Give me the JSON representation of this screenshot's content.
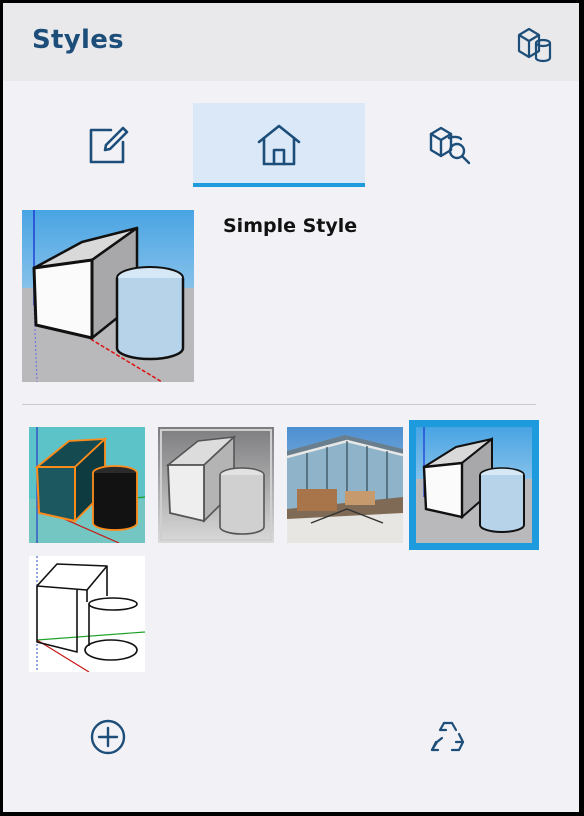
{
  "header": {
    "title": "Styles",
    "icon": "styles-cubes-icon"
  },
  "tabs": [
    {
      "name": "edit",
      "icon": "edit-icon",
      "active": false
    },
    {
      "name": "home",
      "icon": "home-icon",
      "active": true
    },
    {
      "name": "browse",
      "icon": "search-model-icon",
      "active": false
    }
  ],
  "current_style": {
    "name": "Simple Style"
  },
  "thumbnails": [
    {
      "style": "teal-orange-outline",
      "selected": false
    },
    {
      "style": "grayscale",
      "selected": false
    },
    {
      "style": "photo-building",
      "selected": false
    },
    {
      "style": "simple",
      "selected": true
    },
    {
      "style": "wireframe-sketch",
      "selected": false
    }
  ],
  "footer": {
    "add_icon": "add-circle-icon",
    "recycle_icon": "recycle-icon"
  },
  "colors": {
    "accent": "#1e9bdc",
    "title": "#1d4e7a",
    "icon": "#1d4e7a"
  }
}
